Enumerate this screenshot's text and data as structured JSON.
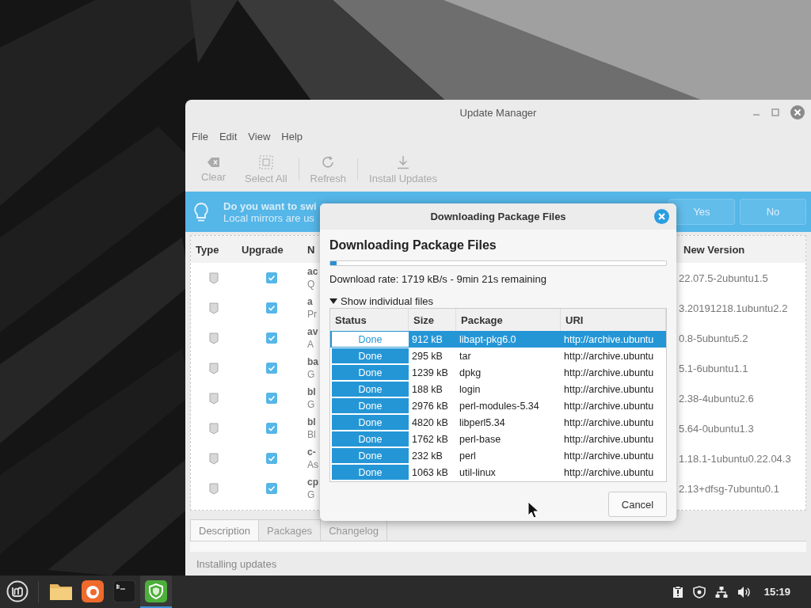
{
  "window": {
    "title": "Update Manager"
  },
  "menu": [
    "File",
    "Edit",
    "View",
    "Help"
  ],
  "toolbar": [
    {
      "kind": "clear",
      "label": "Clear",
      "disabled": true
    },
    {
      "kind": "select",
      "label": "Select All",
      "disabled": true
    },
    {
      "kind": "refresh",
      "label": "Refresh",
      "disabled": true
    },
    {
      "kind": "install",
      "label": "Install Updates",
      "disabled": true
    }
  ],
  "banner": {
    "title": "Do you want to swi",
    "text": "Local mirrors are us",
    "buttons": [
      "Yes",
      "No"
    ]
  },
  "updates": {
    "columns": [
      "Type",
      "Upgrade",
      "N",
      "New Version"
    ],
    "rows": [
      {
        "name": "ac",
        "description": "Q",
        "new_version": "22.07.5-2ubuntu1.5",
        "checked": true
      },
      {
        "name": "a",
        "description": "Pr",
        "new_version": "3.20191218.1ubuntu2.2",
        "checked": true
      },
      {
        "name": "av",
        "description": "A",
        "new_version": "0.8-5ubuntu5.2",
        "checked": true
      },
      {
        "name": "ba",
        "description": "G",
        "new_version": "5.1-6ubuntu1.1",
        "checked": true
      },
      {
        "name": "bl",
        "description": "G",
        "new_version": "2.38-4ubuntu2.6",
        "checked": true
      },
      {
        "name": "bl",
        "description": "Bl",
        "new_version": "5.64-0ubuntu1.3",
        "checked": true
      },
      {
        "name": "c-",
        "description": "As",
        "new_version": "1.18.1-1ubuntu0.22.04.3",
        "checked": true
      },
      {
        "name": "cp",
        "description": "G",
        "new_version": "2.13+dfsg-7ubuntu0.1",
        "checked": true
      }
    ]
  },
  "tabs": [
    {
      "label": "Description",
      "selected": true
    },
    {
      "label": "Packages",
      "selected": false
    },
    {
      "label": "Changelog",
      "selected": false
    }
  ],
  "status_bar": "Installing updates",
  "dialog": {
    "title": "Downloading Package Files",
    "heading": "Downloading Package Files",
    "progress": {
      "level": 0.02
    },
    "rate": "Download rate: 1719 kB/s - 9min 21s remaining",
    "expander": {
      "label": "Show individual files",
      "expanded": true
    },
    "files": {
      "columns": [
        "Status",
        "Size",
        "Package",
        "URI"
      ],
      "rows": [
        {
          "status": "Done",
          "size": "912 kB",
          "package": "libapt-pkg6.0",
          "uri": "http://archive.ubuntu",
          "selected": true
        },
        {
          "status": "Done",
          "size": "295 kB",
          "package": "tar",
          "uri": "http://archive.ubuntu",
          "selected": false
        },
        {
          "status": "Done",
          "size": "1239 kB",
          "package": "dpkg",
          "uri": "http://archive.ubuntu",
          "selected": false
        },
        {
          "status": "Done",
          "size": "188 kB",
          "package": "login",
          "uri": "http://archive.ubuntu",
          "selected": false
        },
        {
          "status": "Done",
          "size": "2976 kB",
          "package": "perl-modules-5.34",
          "uri": "http://archive.ubuntu",
          "selected": false
        },
        {
          "status": "Done",
          "size": "4820 kB",
          "package": "libperl5.34",
          "uri": "http://archive.ubuntu",
          "selected": false
        },
        {
          "status": "Done",
          "size": "1762 kB",
          "package": "perl-base",
          "uri": "http://archive.ubuntu",
          "selected": false
        },
        {
          "status": "Done",
          "size": "232 kB",
          "package": "perl",
          "uri": "http://archive.ubuntu",
          "selected": false
        },
        {
          "status": "Done",
          "size": "1063 kB",
          "package": "util-linux",
          "uri": "http://archive.ubuntu",
          "selected": false
        }
      ]
    },
    "cancel": "Cancel"
  },
  "taskbar": {
    "apps": [
      {
        "kind": "menu",
        "selected": false
      },
      {
        "kind": "files",
        "selected": false
      },
      {
        "kind": "browser",
        "selected": false
      },
      {
        "kind": "terminal",
        "selected": false
      },
      {
        "kind": "update",
        "selected": true
      }
    ],
    "clock": "15:19"
  }
}
